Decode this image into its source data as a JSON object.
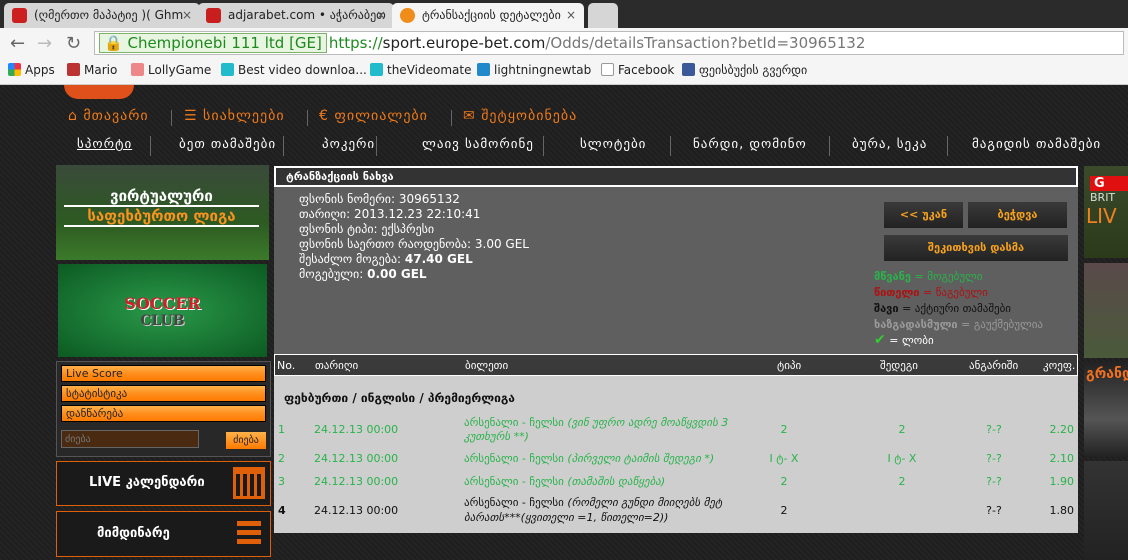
{
  "browser": {
    "tabs": [
      {
        "label": "(ღმერთო მაპატიე )( Ghm",
        "favicon_color": "#cc1f1f"
      },
      {
        "label": "adjarabet.com • აჭარაბეთ",
        "favicon_color": "#c81e1e"
      },
      {
        "label": "ტრანსაქციის დეტალები",
        "favicon_color": "#f08c1a"
      }
    ],
    "close_icon": "×",
    "ev_label": "Chempionebi 111 ltd [GE]",
    "url_scheme": "https://",
    "url_host": "sport.europe-bet.com",
    "url_path": "/Odds/detailsTransaction?betId=30965132",
    "bookmarks": [
      {
        "label": "Apps",
        "color": "#e34"
      },
      {
        "label": "Mario",
        "color": "#b33"
      },
      {
        "label": "LollyGame",
        "color": "#e88"
      },
      {
        "label": "Best video downloa...",
        "color": "#2bc"
      },
      {
        "label": "theVideomate",
        "color": "#2bc"
      },
      {
        "label": "lightningnewtab",
        "color": "#28c"
      },
      {
        "label": "Facebook",
        "color": "#ddd"
      },
      {
        "label": "ფეისბუქის გვერდი",
        "color": "#3b5998"
      }
    ]
  },
  "nav": {
    "top": [
      "მთავარი",
      "სიახლეები",
      "ფილიალები",
      "შეტყობინება"
    ],
    "main": [
      "სპორტი",
      "ბეთ თამაშები",
      "პოკერი",
      "ლაივ სამორინე",
      "სლოტები",
      "ნარდი, დომინო",
      "ბურა, სეკა",
      "მაგიდის თამაშები"
    ],
    "accent": "#f07a1a"
  },
  "left": {
    "banner1_line1": "ვირტუალური",
    "banner1_line2": "საფეხბურთო ლიგა",
    "banner2_line1": "SOCCER",
    "banner2_line2": "CLUB",
    "menu": [
      "Live Score",
      "სტატისტიკა",
      "დანწარება"
    ],
    "search_placeholder": "ძიება",
    "search_button": "ძიება",
    "live_calendar": "LIVE კალენდარი",
    "current": "მიმდინარე"
  },
  "panel": {
    "title": "ტრანზაქციის ნახვა",
    "info": [
      {
        "label": "ფსონის ნომერი: ",
        "value": "30965132",
        "bold": false
      },
      {
        "label": "თარიღი: ",
        "value": "2013.12.23 22:10:41",
        "bold": false
      },
      {
        "label": "ფსონის ტიპი: ",
        "value": "ექსპრესი",
        "bold": false
      },
      {
        "label": "ფსონის საერთო რაოდენობა: ",
        "value": "3.00 GEL",
        "bold": false
      },
      {
        "label": "შესაძლო მოგება: ",
        "value": "47.40 GEL",
        "bold": true
      },
      {
        "label": "მოგებული: ",
        "value": "0.00 GEL",
        "bold": true
      }
    ],
    "buttons": {
      "back": "<< უკან",
      "print": "ბეჭდვა",
      "check": "შეკითხვის დასმა"
    },
    "legend": [
      {
        "key": "მწვანე",
        "text": " = მოგებული",
        "color": "#28b44a"
      },
      {
        "key": "წითელი",
        "text": " = წაგებული",
        "color": "#b01010"
      },
      {
        "key": "შავი",
        "text": " = აქტიური თამაშები",
        "color": "#111111"
      },
      {
        "key": "ხაზგადასმული",
        "text": " = გაუქმებულია",
        "color": "#9a9a9a"
      }
    ],
    "legend_check": "= ლობი",
    "table": {
      "headers": [
        "No.",
        "თარიღი",
        "ბილეთი",
        "ტიპი",
        "შედეგი",
        "ანგარიში",
        "კოეფ."
      ],
      "section": "ფეხბურთი / ინგლისი / პრემიერლიგა",
      "rows": [
        {
          "no": "1",
          "date": "24.12.13 00:00",
          "match": "არსენალი - ჩელსი ",
          "bet": "(ვინ უფრო ადრე მოაწყვდის 3",
          "bet2": "კუთხურს **)",
          "type": "2",
          "result": "2",
          "score": "?-?",
          "coef": "2.20",
          "status": "green"
        },
        {
          "no": "2",
          "date": "24.12.13 00:00",
          "match": "არსენალი - ჩელსი ",
          "bet": "(პირველი ტაიმის შედეგი *)",
          "bet2": "",
          "type": "I ტ- X",
          "result": "I ტ- X",
          "score": "?-?",
          "coef": "2.10",
          "status": "green"
        },
        {
          "no": "3",
          "date": "24.12.13 00:00",
          "match": "არსენალი - ჩელსი ",
          "bet": "(თამაშის დაწყება)",
          "bet2": "",
          "type": "2",
          "result": "2",
          "score": "?-?",
          "coef": "1.90",
          "status": "green"
        },
        {
          "no": "4",
          "date": "24.12.13 00:00",
          "match": "არსენალი - ჩელსი ",
          "bet": "(რომელი გუნდი მიიღებს მეტ",
          "bet2": "ბარათს***(ყვითელი =1, წითელი=2))",
          "type": "2",
          "result": "",
          "score": "?-?",
          "coef": "1.80",
          "status": "dark"
        }
      ]
    }
  },
  "right": {
    "banner1": "G",
    "banner1_sub": "BRIT",
    "banner1_live": "LIV",
    "banner3": "გრანდ"
  }
}
